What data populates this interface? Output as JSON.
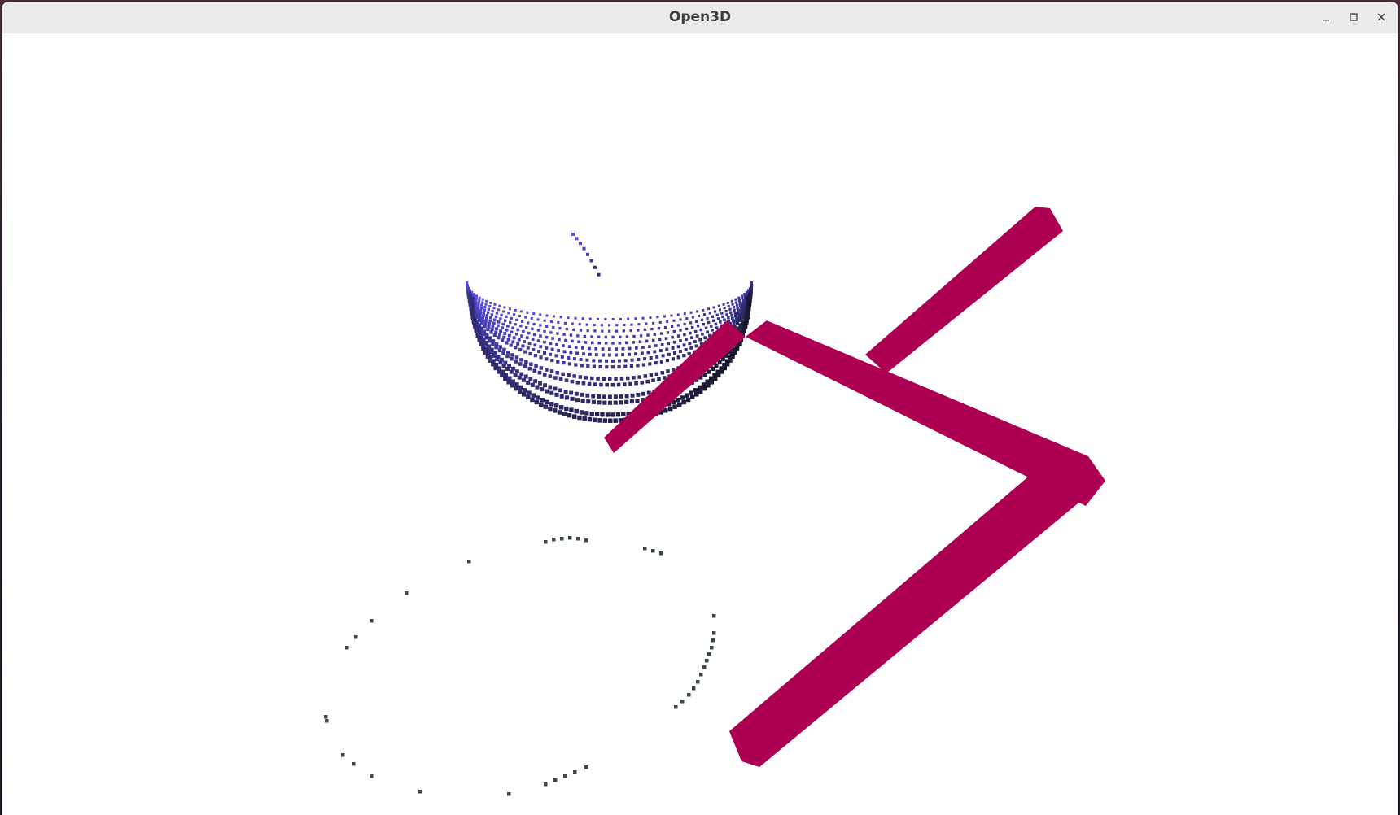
{
  "window": {
    "title": "Open3D"
  },
  "controls": {
    "minimize_icon": "minimize-icon",
    "maximize_icon": "maximize-icon",
    "close_icon": "close-icon"
  },
  "scene": {
    "background": "#ffffff",
    "frame_color": "#ad0052",
    "cloud_top_color": "#5a4ff0",
    "cloud_bottom_color": "#1a1a30",
    "ring_point_color": "#3c4a44"
  }
}
